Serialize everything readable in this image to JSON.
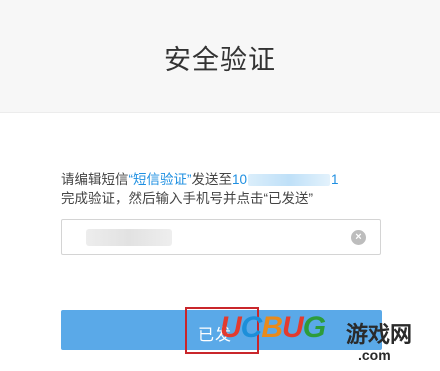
{
  "header": {
    "title": "安全验证"
  },
  "instructions": {
    "line1_prefix": "请编辑短信",
    "sms_keyword": "“短信验证”",
    "line1_mid": "发送至",
    "number_start": "10",
    "number_end": "1",
    "line2": "完成验证，然后输入手机号并点击“已发送”"
  },
  "phone_input": {
    "clear_icon": "×"
  },
  "submit": {
    "label": "已发"
  },
  "watermark": {
    "logo": [
      "U",
      "C",
      "B",
      "U",
      "G"
    ],
    "cn": "游戏网",
    "domain": ".com"
  },
  "colors": {
    "accent": "#1e8fe1",
    "button": "#5aa9e8",
    "highlight_border": "#c9262b"
  }
}
